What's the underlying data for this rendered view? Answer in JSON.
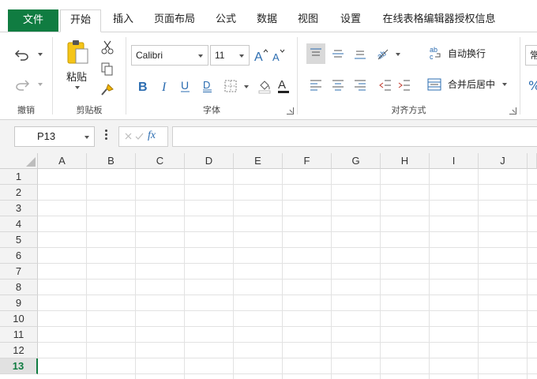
{
  "tabs": [
    {
      "label": "文件"
    },
    {
      "label": "开始"
    },
    {
      "label": "插入"
    },
    {
      "label": "页面布局"
    },
    {
      "label": "公式"
    },
    {
      "label": "数据"
    },
    {
      "label": "视图"
    },
    {
      "label": "设置"
    },
    {
      "label": "在线表格编辑器授权信息"
    }
  ],
  "ribbon": {
    "undo_group_label": "撤销",
    "clipboard": {
      "paste_label": "粘贴",
      "group_label": "剪贴板"
    },
    "font": {
      "family": "Calibri",
      "size": "11",
      "group_label": "字体"
    },
    "alignment": {
      "wrap_label": "自动换行",
      "merge_label": "合并后居中",
      "group_label": "对齐方式"
    },
    "number": {
      "format_partial": "常",
      "percent_symbol": "%"
    }
  },
  "formula_bar": {
    "name_box": "P13",
    "fx": "fx",
    "formula": ""
  },
  "grid": {
    "columns": [
      "A",
      "B",
      "C",
      "D",
      "E",
      "F",
      "G",
      "H",
      "I",
      "J"
    ],
    "rows": [
      "1",
      "2",
      "3",
      "4",
      "5",
      "6",
      "7",
      "8",
      "9",
      "10",
      "11",
      "12",
      "13"
    ],
    "active_row": "13"
  },
  "colors": {
    "accent": "#107c41",
    "icon_blue": "#2b6cb0"
  }
}
